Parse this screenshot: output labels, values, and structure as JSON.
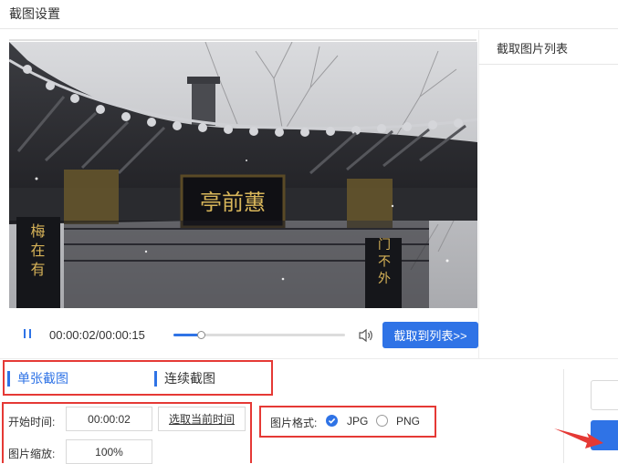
{
  "window": {
    "title": "截图设置"
  },
  "right_panel": {
    "title": "截取图片列表"
  },
  "player": {
    "pause_icon": "pause-icon",
    "current_time": "00:00:02",
    "separator": "/",
    "duration": "00:00:15",
    "progress": 0.16,
    "volume_icon": "speaker-icon",
    "capture_button": "截取到列表>>"
  },
  "video_frame": {
    "plaque_text": "亭前蕙",
    "left_couplet": "梅 在 有",
    "right_couplet": "门 不 外"
  },
  "tabs": [
    {
      "label": "单张截图",
      "active": true
    },
    {
      "label": "连续截图",
      "active": false
    }
  ],
  "settings": {
    "start_time_label": "开始时间:",
    "start_time_value": "00:00:02",
    "select_current_button": "选取当前时间",
    "scale_label": "图片缩放:",
    "scale_value": "100%"
  },
  "format": {
    "label": "图片格式:",
    "options": [
      {
        "label": "JPG",
        "selected": true
      },
      {
        "label": "PNG",
        "selected": false
      }
    ]
  },
  "colors": {
    "accent": "#2f73e6",
    "highlight": "#e53935"
  }
}
